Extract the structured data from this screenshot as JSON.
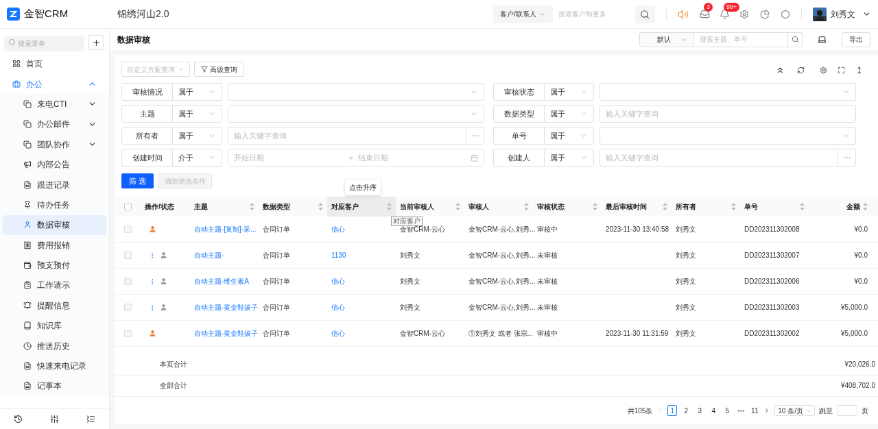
{
  "header": {
    "logo": "金智CRM",
    "title": "锦绣河山2.0",
    "search_scope": "客户/联系人",
    "search": {
      "placeholder": "搜索客户和更多"
    },
    "badges": [
      "3",
      "99+"
    ],
    "user": "刘秀文"
  },
  "sidebar": {
    "search": {
      "placeholder": "搜索菜单"
    },
    "items": [
      {
        "label": "首页",
        "selected": false
      },
      {
        "label": "办公",
        "selected": false,
        "expanded": true,
        "children": [
          {
            "label": "来电CTI",
            "selected": false,
            "expanded": false,
            "expandable": true
          },
          {
            "label": "办公邮件",
            "selected": false,
            "expanded": false,
            "expandable": true
          },
          {
            "label": "团队协作",
            "selected": false,
            "expanded": false,
            "expandable": true
          },
          {
            "label": "内部公告",
            "selected": false
          },
          {
            "label": "跟进记录",
            "selected": false
          },
          {
            "label": "待办任务",
            "selected": false
          },
          {
            "label": "数据审核",
            "selected": true
          },
          {
            "label": "费用报销",
            "selected": false
          },
          {
            "label": "预支预付",
            "selected": false
          },
          {
            "label": "工作请示",
            "selected": false
          },
          {
            "label": "提醒信息",
            "selected": false
          },
          {
            "label": "知识库",
            "selected": false
          },
          {
            "label": "推送历史",
            "selected": false
          },
          {
            "label": "快速来电记录",
            "selected": false
          },
          {
            "label": "记事本",
            "selected": false
          }
        ]
      }
    ]
  },
  "page": {
    "title": "数据审核",
    "view": "默认",
    "search": {
      "placeholder": "搜索主题、单号"
    },
    "export": "导出"
  },
  "toolbar": {
    "scheme": {
      "placeholder": "自定义方案查询"
    },
    "advanced": "高级查询"
  },
  "filters": [
    {
      "label": "审核情况",
      "operator": "属于",
      "kind": "select"
    },
    {
      "label": "审核状态",
      "operator": "属于",
      "kind": "select"
    },
    {
      "label": "主题",
      "operator": "属于",
      "kind": "select"
    },
    {
      "label": "数据类型",
      "operator": "属于",
      "kind": "text",
      "placeholder": "输入关键字查询"
    },
    {
      "label": "所有者",
      "operator": "属于",
      "kind": "picker",
      "placeholder": "输入关键字查询"
    },
    {
      "label": "单号",
      "operator": "属于",
      "kind": "select"
    },
    {
      "label": "创建时间",
      "operator": "介于",
      "kind": "date",
      "placeholder": "开始日期",
      "placeholder_end": "结束日期"
    },
    {
      "label": "创建人",
      "operator": "属于",
      "kind": "picker",
      "placeholder": "输入关键字查询"
    }
  ],
  "filter_buttons": {
    "apply": "筛 选",
    "clear": "清除筛选条件",
    "clear_disabled": true
  },
  "table": {
    "columns": [
      {
        "label": "操作/状态",
        "sortable": false,
        "highlighted": false
      },
      {
        "label": "主题",
        "sortable": true,
        "highlighted": false
      },
      {
        "label": "数据类型",
        "sortable": true,
        "highlighted": false
      },
      {
        "label": "对应客户",
        "sortable": true,
        "highlighted": true
      },
      {
        "label": "当前审核人",
        "sortable": true,
        "highlighted": false
      },
      {
        "label": "审核人",
        "sortable": true,
        "highlighted": false
      },
      {
        "label": "审核状态",
        "sortable": true,
        "highlighted": false
      },
      {
        "label": "最后审核时间",
        "sortable": true,
        "highlighted": false
      },
      {
        "label": "所有者",
        "sortable": true,
        "highlighted": false
      },
      {
        "label": "单号",
        "sortable": true,
        "highlighted": false
      },
      {
        "label": "金额",
        "sortable": true,
        "highlighted": false
      }
    ],
    "select_all_checked": false,
    "tooltip": "点击升序",
    "hover_hint": "对应客户",
    "rows": [
      {
        "checked": false,
        "kind": "active",
        "cells": [
          "",
          "自动主题-[复制]-采...",
          "合同订单",
          "信心",
          "金智CRM-云心",
          "金智CRM-云心,刘秀...",
          "审核中",
          "2023-11-30 13:40:58",
          "刘秀文",
          "DD202311302008",
          "¥0.0"
        ]
      },
      {
        "checked": false,
        "kind": "idle",
        "cells": [
          "",
          "自动主题-",
          "合同订单",
          "1130",
          "刘秀文",
          "金智CRM-云心,刘秀...",
          "未审核",
          "",
          "刘秀文",
          "DD202311302007",
          "¥0.0"
        ]
      },
      {
        "checked": false,
        "kind": "idle",
        "cells": [
          "",
          "自动主题-维生素A",
          "合同订单",
          "信心",
          "刘秀文",
          "金智CRM-云心,刘秀...",
          "未审核",
          "",
          "刘秀文",
          "DD202311302006",
          "¥0.0"
        ]
      },
      {
        "checked": false,
        "kind": "idle",
        "cells": [
          "",
          "自动主题-黄金鞋拔子",
          "合同订单",
          "信心",
          "刘秀文",
          "金智CRM-云心,刘秀...",
          "未审核",
          "",
          "刘秀文",
          "DD202311302003",
          "¥5,000.0"
        ]
      },
      {
        "checked": false,
        "kind": "active",
        "cells": [
          "",
          "自动主题-黄金鞋拔子",
          "合同订单",
          "信心",
          "金智CRM-云心",
          "①刘秀文 或者 张宗...",
          "审核中",
          "2023-11-30 11:31:59",
          "刘秀文",
          "DD202311302002",
          "¥5,000.0"
        ]
      }
    ],
    "totals": [
      {
        "label": "本页合计",
        "value": "¥20,026.0"
      },
      {
        "label": "全部合计",
        "value": "¥408,702.0"
      }
    ]
  },
  "pagination": {
    "total": "共105条",
    "pages": [
      {
        "label": "1",
        "selected": true
      },
      {
        "label": "2",
        "selected": false
      },
      {
        "label": "3",
        "selected": false
      },
      {
        "label": "4",
        "selected": false
      },
      {
        "label": "5",
        "selected": false
      },
      {
        "label": "•••",
        "selected": false
      },
      {
        "label": "11",
        "selected": false
      }
    ],
    "page_size": "10 条/页",
    "jump": "跳至",
    "unit": "页"
  }
}
